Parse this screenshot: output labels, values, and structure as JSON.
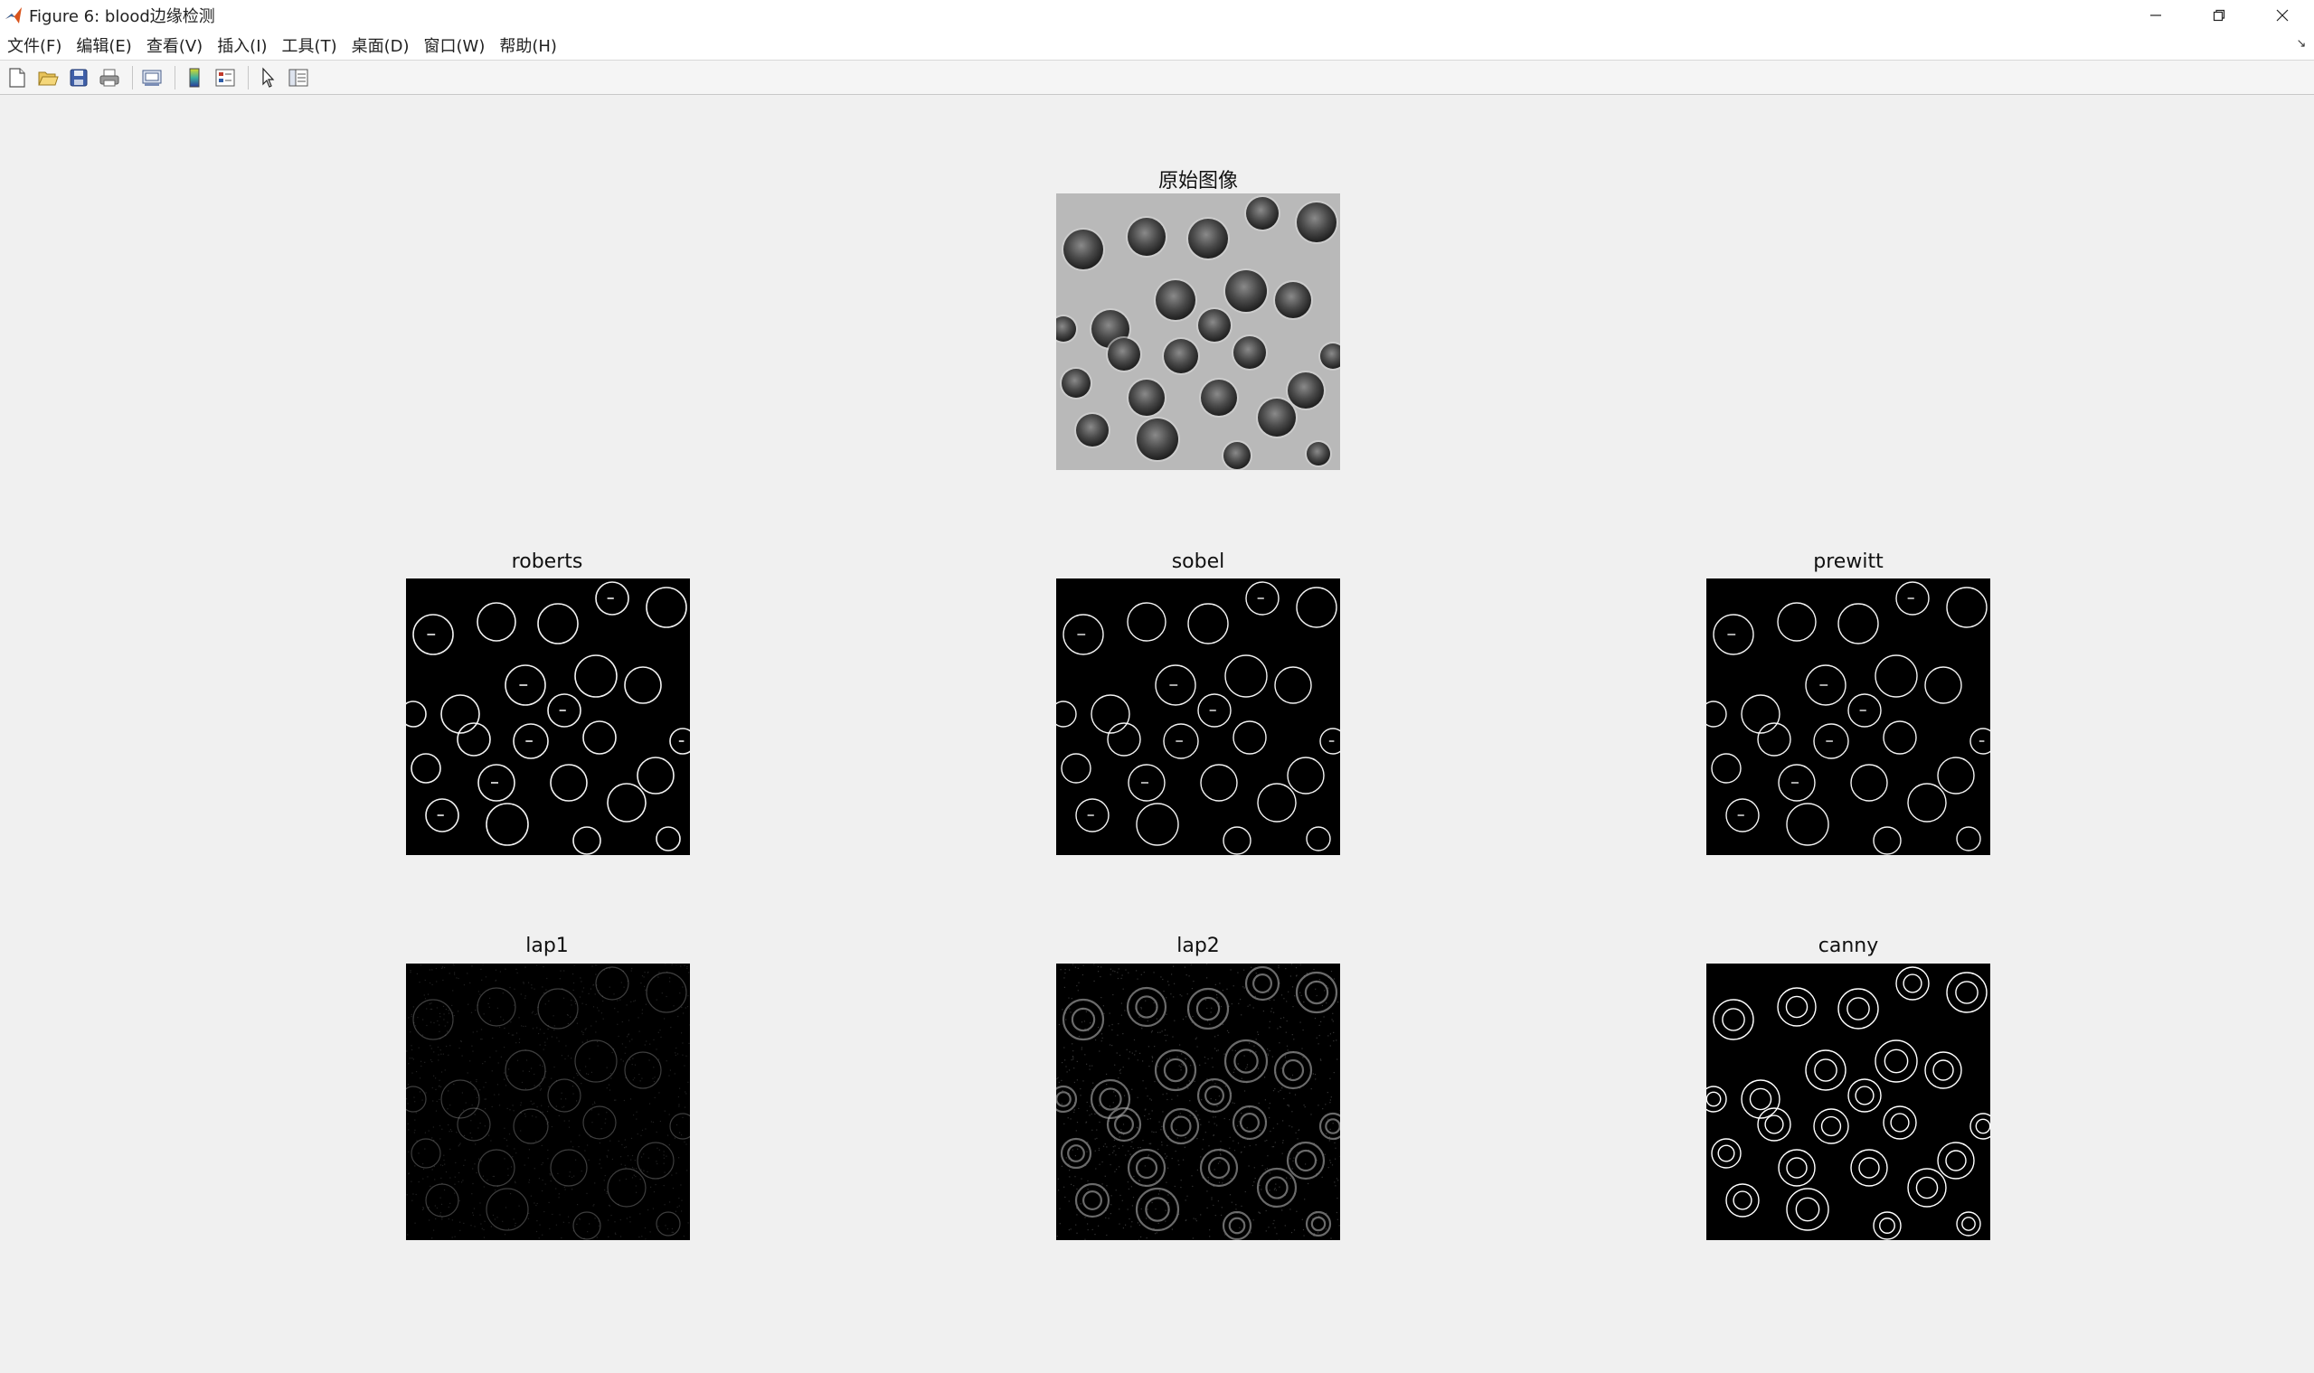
{
  "window": {
    "title": "Figure 6: blood边缘检测"
  },
  "menu": {
    "items": [
      "文件(F)",
      "编辑(E)",
      "查看(V)",
      "插入(I)",
      "工具(T)",
      "桌面(D)",
      "窗口(W)",
      "帮助(H)"
    ]
  },
  "toolbar": {
    "icons": [
      "new-figure-icon",
      "open-file-icon",
      "save-icon",
      "print-icon",
      "print-preview-icon",
      "colorbar-icon",
      "legend-icon",
      "pointer-icon",
      "property-inspector-icon"
    ]
  },
  "subplots": {
    "original": {
      "title": "原始图像"
    },
    "roberts": {
      "title": "roberts"
    },
    "sobel": {
      "title": "sobel"
    },
    "prewitt": {
      "title": "prewitt"
    },
    "lap1": {
      "title": "lap1"
    },
    "lap2": {
      "title": "lap2"
    },
    "canny": {
      "title": "canny"
    }
  },
  "colors": {
    "figure_bg": "#f0f0f0",
    "edge_bg": "#000000",
    "cell_gray": "#b9b9b9"
  }
}
